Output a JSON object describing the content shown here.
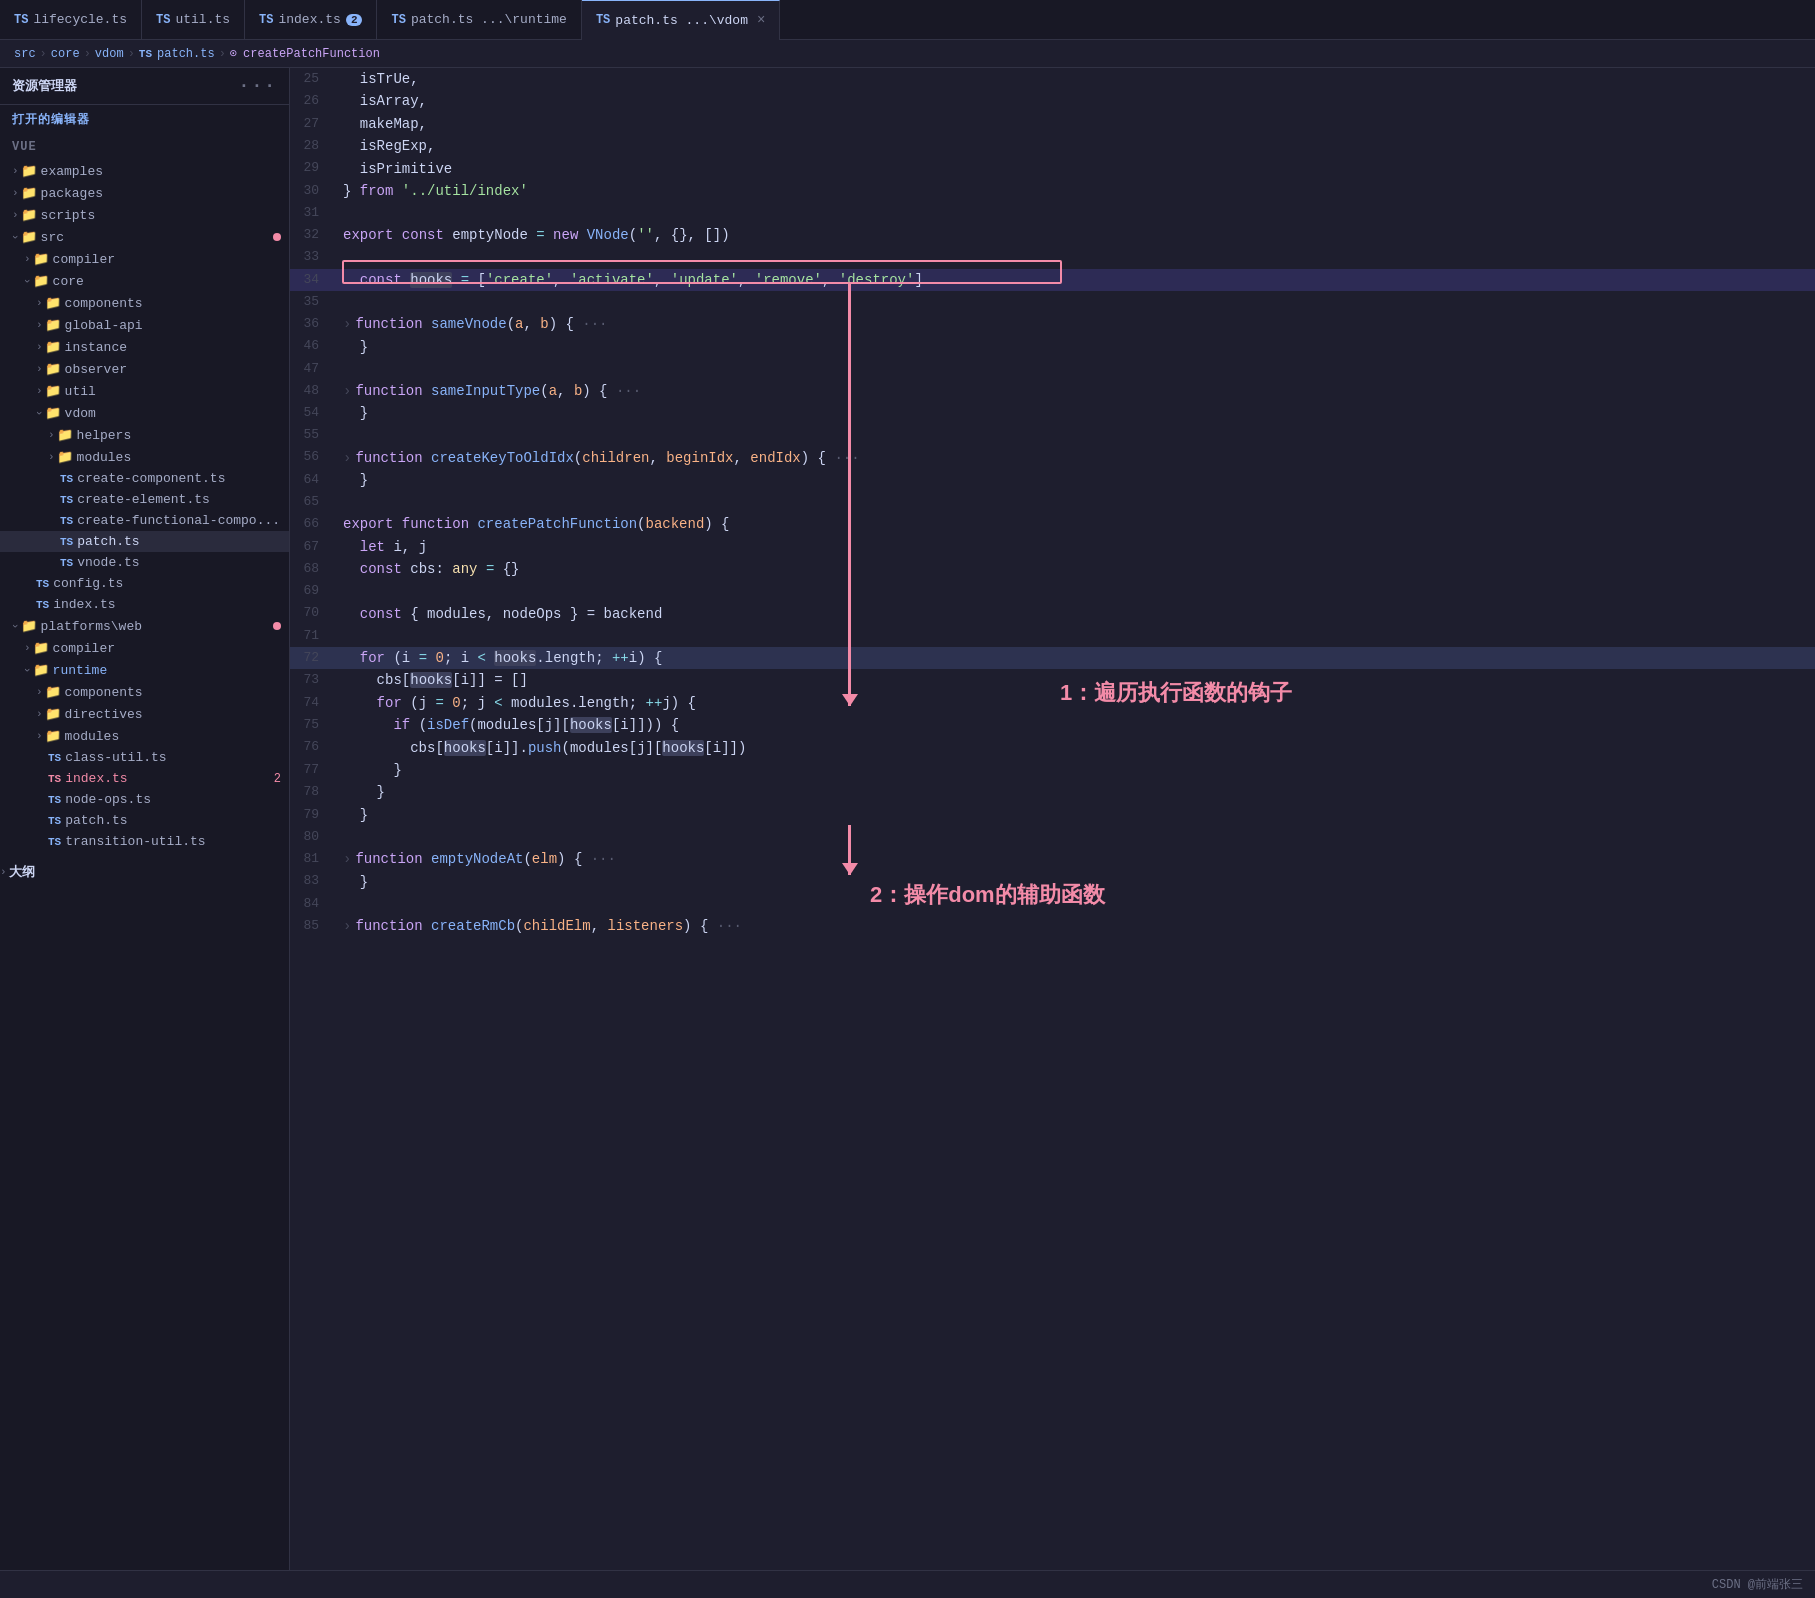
{
  "sidebar": {
    "title": "资源管理器",
    "section": "打开的编辑器",
    "vueLabel": "VUE",
    "tree": [
      {
        "id": "examples",
        "label": "examples",
        "type": "folder",
        "indent": 1,
        "collapsed": true
      },
      {
        "id": "packages",
        "label": "packages",
        "type": "folder",
        "indent": 1,
        "collapsed": true
      },
      {
        "id": "scripts",
        "label": "scripts",
        "type": "folder",
        "indent": 1,
        "collapsed": true
      },
      {
        "id": "src",
        "label": "src",
        "type": "folder",
        "indent": 1,
        "collapsed": false,
        "dot": true
      },
      {
        "id": "compiler",
        "label": "compiler",
        "type": "folder",
        "indent": 2,
        "collapsed": true
      },
      {
        "id": "core",
        "label": "core",
        "type": "folder",
        "indent": 2,
        "collapsed": false
      },
      {
        "id": "components",
        "label": "components",
        "type": "folder",
        "indent": 3,
        "collapsed": true
      },
      {
        "id": "global-api",
        "label": "global-api",
        "type": "folder",
        "indent": 3,
        "collapsed": true
      },
      {
        "id": "instance",
        "label": "instance",
        "type": "folder",
        "indent": 3,
        "collapsed": true
      },
      {
        "id": "observer",
        "label": "observer",
        "type": "folder",
        "indent": 3,
        "collapsed": true
      },
      {
        "id": "util",
        "label": "util",
        "type": "folder",
        "indent": 3,
        "collapsed": true
      },
      {
        "id": "vdom",
        "label": "vdom",
        "type": "folder",
        "indent": 3,
        "collapsed": false
      },
      {
        "id": "helpers",
        "label": "helpers",
        "type": "folder",
        "indent": 4,
        "collapsed": true
      },
      {
        "id": "modules",
        "label": "modules",
        "type": "folder",
        "indent": 4,
        "collapsed": true
      },
      {
        "id": "create-component",
        "label": "create-component.ts",
        "type": "ts",
        "indent": 4
      },
      {
        "id": "create-element",
        "label": "create-element.ts",
        "type": "ts",
        "indent": 4
      },
      {
        "id": "create-functional-compo",
        "label": "create-functional-compo...",
        "type": "ts",
        "indent": 4
      },
      {
        "id": "patch",
        "label": "patch.ts",
        "type": "ts",
        "indent": 4,
        "active": true
      },
      {
        "id": "vnode",
        "label": "vnode.ts",
        "type": "ts",
        "indent": 4
      },
      {
        "id": "config",
        "label": "config.ts",
        "type": "ts",
        "indent": 2
      },
      {
        "id": "index-ts",
        "label": "index.ts",
        "type": "ts",
        "indent": 2
      },
      {
        "id": "platforms-web",
        "label": "platforms\\web",
        "type": "folder",
        "indent": 1,
        "collapsed": false,
        "dot": true
      },
      {
        "id": "compiler2",
        "label": "compiler",
        "type": "folder",
        "indent": 2,
        "collapsed": true
      },
      {
        "id": "runtime",
        "label": "runtime",
        "type": "folder",
        "indent": 2,
        "collapsed": false,
        "highlighted": true
      },
      {
        "id": "components2",
        "label": "components",
        "type": "folder",
        "indent": 3,
        "collapsed": true
      },
      {
        "id": "directives",
        "label": "directives",
        "type": "folder",
        "indent": 3,
        "collapsed": true
      },
      {
        "id": "modules2",
        "label": "modules",
        "type": "folder",
        "indent": 3,
        "collapsed": true
      },
      {
        "id": "class-util",
        "label": "class-util.ts",
        "type": "ts",
        "indent": 3
      },
      {
        "id": "index-ts2",
        "label": "index.ts",
        "type": "ts",
        "indent": 3,
        "badgeNum": "2",
        "badgeColor": "red"
      },
      {
        "id": "node-ops",
        "label": "node-ops.ts",
        "type": "ts",
        "indent": 3
      },
      {
        "id": "patch2",
        "label": "patch.ts",
        "type": "ts",
        "indent": 3
      },
      {
        "id": "transition-util",
        "label": "transition-util.ts",
        "type": "ts",
        "indent": 3
      },
      {
        "id": "outline",
        "label": "大纲",
        "type": "section",
        "indent": 0
      }
    ]
  },
  "tabs": [
    {
      "id": "lifecycle",
      "label": "lifecycle.ts",
      "ts": true,
      "active": false
    },
    {
      "id": "util",
      "label": "util.ts",
      "ts": true,
      "active": false
    },
    {
      "id": "index",
      "label": "index.ts",
      "ts": true,
      "active": false,
      "badge": "2"
    },
    {
      "id": "patch-runtime",
      "label": "patch.ts ...\\runtime",
      "ts": true,
      "active": false
    },
    {
      "id": "patch-vdom",
      "label": "patch.ts ...\\vdom",
      "ts": true,
      "active": true,
      "close": true
    }
  ],
  "breadcrumb": [
    "src",
    "core",
    "vdom",
    "patch.ts",
    "createPatchFunction"
  ],
  "code": {
    "lines": [
      {
        "num": 25,
        "content": "  isTrUe,"
      },
      {
        "num": 26,
        "content": "  isArray,"
      },
      {
        "num": 27,
        "content": "  makeMap,"
      },
      {
        "num": 28,
        "content": "  isRegExp,"
      },
      {
        "num": 29,
        "content": "  isPrimitive"
      },
      {
        "num": 30,
        "content": "} from '../util/index'"
      },
      {
        "num": 31,
        "content": ""
      },
      {
        "num": 32,
        "content": "export const emptyNode = new VNode('', {}, [])"
      },
      {
        "num": 33,
        "content": ""
      },
      {
        "num": 34,
        "content": "  const hooks = ['create', 'activate', 'update', 'remove', 'destroy']",
        "highlighted": true,
        "boxed": true
      },
      {
        "num": 35,
        "content": ""
      },
      {
        "num": 36,
        "content": "  function sameVnode(a, b) { ···",
        "fold": true
      },
      {
        "num": 46,
        "content": "  }"
      },
      {
        "num": 47,
        "content": ""
      },
      {
        "num": 48,
        "content": "  function sameInputType(a, b) { ···",
        "fold": true
      },
      {
        "num": 54,
        "content": "  }"
      },
      {
        "num": 55,
        "content": ""
      },
      {
        "num": 56,
        "content": "  function createKeyToOldIdx(children, beginIdx, endIdx) { ···",
        "fold": true
      },
      {
        "num": 64,
        "content": "  }"
      },
      {
        "num": 65,
        "content": ""
      },
      {
        "num": 66,
        "content": "export function createPatchFunction(backend) {"
      },
      {
        "num": 67,
        "content": "  let i, j"
      },
      {
        "num": 68,
        "content": "  const cbs: any = {}"
      },
      {
        "num": 69,
        "content": ""
      },
      {
        "num": 70,
        "content": "  const { modules, nodeOps } = backend"
      },
      {
        "num": 71,
        "content": ""
      },
      {
        "num": 72,
        "content": "  for (i = 0; i < hooks.length; ++i) {",
        "annotation1": true
      },
      {
        "num": 73,
        "content": "    cbs[hooks[i]] = []"
      },
      {
        "num": 74,
        "content": "    for (j = 0; j < modules.length; ++j) {"
      },
      {
        "num": 75,
        "content": "      if (isDef(modules[j][hooks[i]])) {"
      },
      {
        "num": 76,
        "content": "        cbs[hooks[i]].push(modules[j][hooks[i]])"
      },
      {
        "num": 77,
        "content": "      }"
      },
      {
        "num": 78,
        "content": "    }"
      },
      {
        "num": 79,
        "content": "  }"
      },
      {
        "num": 80,
        "content": ""
      },
      {
        "num": 81,
        "content": "  function emptyNodeAt(elm) { ···",
        "fold": true,
        "annotation2": true
      },
      {
        "num": 83,
        "content": "  }"
      },
      {
        "num": 84,
        "content": ""
      },
      {
        "num": 85,
        "content": "  function createRmCb(childElm, listeners) { ···",
        "fold": true
      }
    ]
  },
  "annotations": {
    "arrow1text": "1：遍历执行函数的钩子",
    "arrow2text": "2：操作dom的辅助函数"
  },
  "bottomBar": {
    "credit": "CSDN @前端张三"
  }
}
